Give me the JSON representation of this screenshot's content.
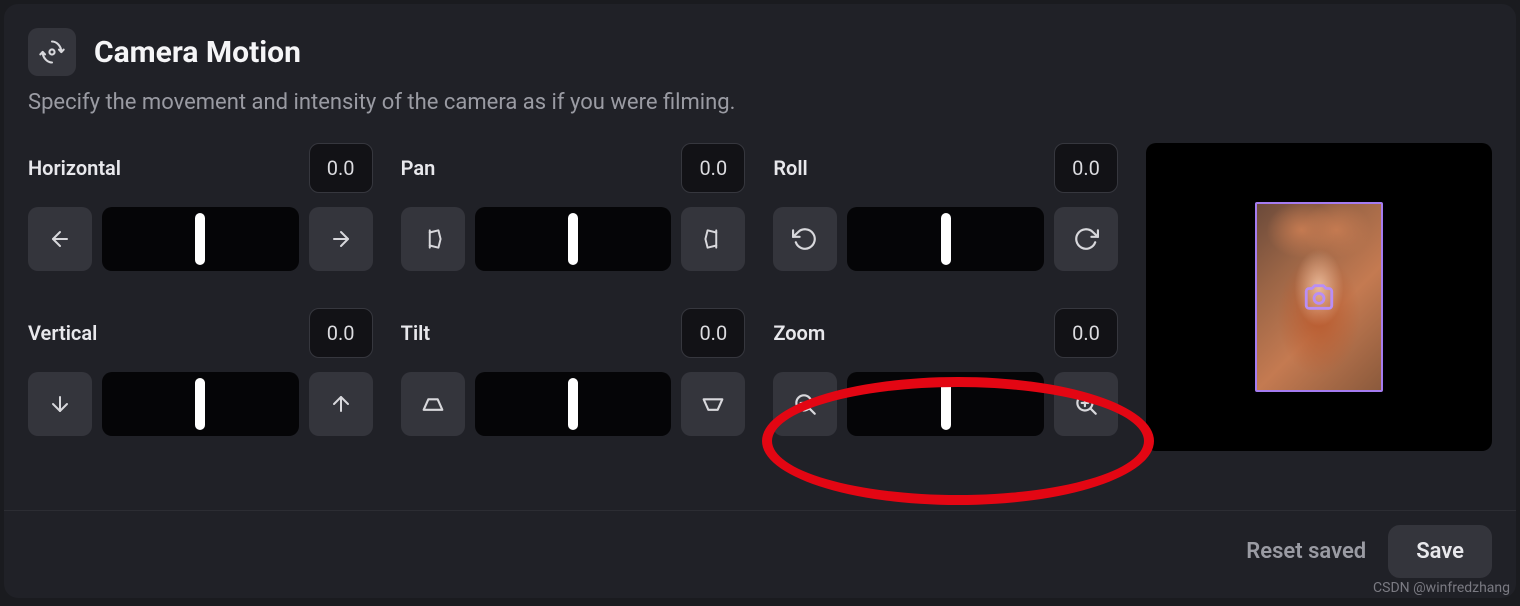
{
  "header": {
    "title": "Camera Motion",
    "subtitle": "Specify the movement and intensity of the camera as if you were filming."
  },
  "controls": {
    "horizontal": {
      "label": "Horizontal",
      "value": "0.0"
    },
    "pan": {
      "label": "Pan",
      "value": "0.0"
    },
    "roll": {
      "label": "Roll",
      "value": "0.0"
    },
    "vertical": {
      "label": "Vertical",
      "value": "0.0"
    },
    "tilt": {
      "label": "Tilt",
      "value": "0.0"
    },
    "zoom": {
      "label": "Zoom",
      "value": "0.0"
    }
  },
  "footer": {
    "reset": "Reset saved",
    "save": "Save"
  },
  "watermark": "CSDN @winfredzhang",
  "highlight": {
    "target": "zoom-slider",
    "shape": "ellipse",
    "color": "#e30613"
  }
}
